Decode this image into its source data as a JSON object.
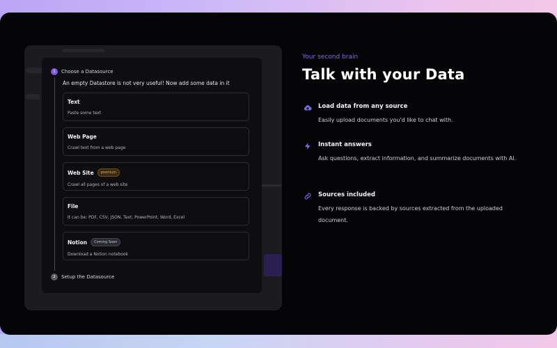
{
  "steps": {
    "choose_label": "Choose a Datasource",
    "choose_num": "1",
    "setup_label": "Setup the Datasource",
    "setup_num": "2"
  },
  "intro": "An empty Datastore is not very useful! Now add some data in it",
  "options": [
    {
      "title": "Text",
      "description": "Paste some text",
      "badge": ""
    },
    {
      "title": "Web Page",
      "description": "Crawl text from a web page",
      "badge": ""
    },
    {
      "title": "Web Site",
      "description": "Crawl all pages of a web site",
      "badge": "premium"
    },
    {
      "title": "File",
      "description": "It can be: PDF, CSV, JSON, Text, PowerPoint, Word, Excel",
      "badge": ""
    },
    {
      "title": "Notion",
      "description": "Download a Notion notebook",
      "badge": "Coming Soon"
    }
  ],
  "hero": {
    "kicker": "Your second brain",
    "headline": "Talk with your Data"
  },
  "features": [
    {
      "icon": "cloud-upload-icon",
      "title": "Load data from any source",
      "description": "Easily upload documents you'd like to chat with."
    },
    {
      "icon": "lightning-icon",
      "title": "Instant answers",
      "description": "Ask questions, extract information, and summarize documents with AI."
    },
    {
      "icon": "link-icon",
      "title": "Sources included",
      "description": "Every response is backed by sources extracted from the uploaded document."
    }
  ],
  "colors": {
    "accent": "#7b6ff0",
    "step_active": "#7c5bd6",
    "premium": "#e0b060",
    "background": "#050507"
  }
}
